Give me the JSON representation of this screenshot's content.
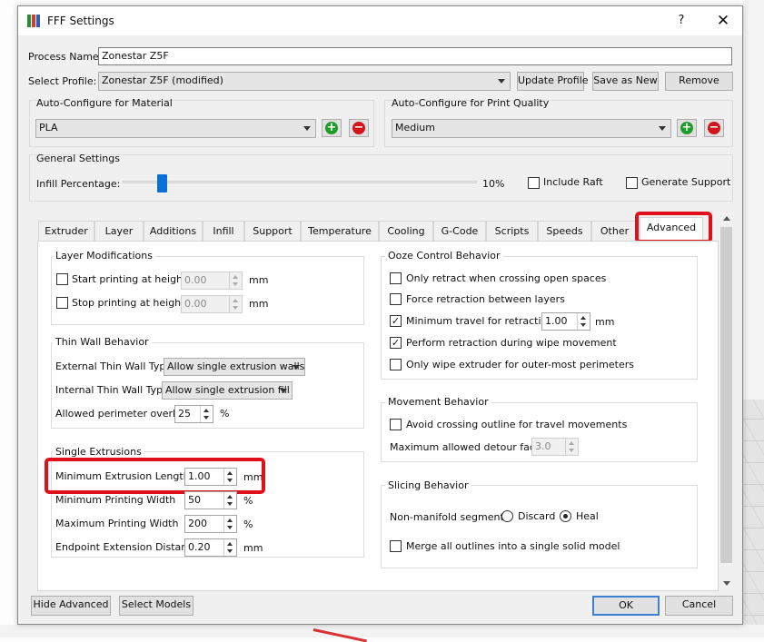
{
  "window": {
    "title": "FFF Settings",
    "help": "?",
    "close": "✕"
  },
  "process_name": {
    "label": "Process Name:",
    "value": "Zonestar Z5F"
  },
  "select_profile": {
    "label": "Select Profile:",
    "value": "Zonestar Z5F (modified)",
    "update": "Update Profile",
    "save_as_new": "Save as New",
    "remove": "Remove"
  },
  "material": {
    "title": "Auto-Configure for Material",
    "value": "PLA",
    "add": "+",
    "remove": "−"
  },
  "quality": {
    "title": "Auto-Configure for Print Quality",
    "value": "Medium",
    "add": "+",
    "remove": "−"
  },
  "general": {
    "title": "General Settings",
    "infill_label": "Infill Percentage:",
    "infill_value": "10%",
    "infill_fraction": 0.1,
    "include_raft": "Include Raft",
    "generate_support": "Generate Support"
  },
  "tabs": [
    "Extruder",
    "Layer",
    "Additions",
    "Infill",
    "Support",
    "Temperature",
    "Cooling",
    "G-Code",
    "Scripts",
    "Speeds",
    "Other",
    "Advanced"
  ],
  "layer_mod": {
    "title": "Layer Modifications",
    "start_label": "Start printing at height",
    "start_value": "0.00",
    "start_unit": "mm",
    "stop_label": "Stop printing at height",
    "stop_value": "0.00",
    "stop_unit": "mm"
  },
  "thin_wall": {
    "title": "Thin Wall Behavior",
    "external_label": "External Thin Wall Type",
    "external_value": "Allow single extrusion walls",
    "internal_label": "Internal Thin Wall Type",
    "internal_value": "Allow single extrusion fill",
    "overlap_label": "Allowed perimeter overlap",
    "overlap_value": "25",
    "overlap_unit": "%"
  },
  "single_ext": {
    "title": "Single Extrusions",
    "min_len_label": "Minimum Extrusion Length",
    "min_len_value": "1.00",
    "min_len_unit": "mm",
    "min_width_label": "Minimum Printing Width",
    "min_width_value": "50",
    "min_width_unit": "%",
    "max_width_label": "Maximum Printing Width",
    "max_width_value": "200",
    "max_width_unit": "%",
    "endpoint_label": "Endpoint Extension Distance",
    "endpoint_value": "0.20",
    "endpoint_unit": "mm"
  },
  "ooze": {
    "title": "Ooze Control Behavior",
    "only_retract": "Only retract when crossing open spaces",
    "force_retract": "Force retraction between layers",
    "min_travel": "Minimum travel for retraction",
    "min_travel_value": "1.00",
    "min_travel_unit": "mm",
    "wipe_retract": "Perform retraction during wipe movement",
    "only_wipe": "Only wipe extruder for outer-most perimeters",
    "check_marks": "✓"
  },
  "movement": {
    "title": "Movement Behavior",
    "avoid": "Avoid crossing outline for travel movements",
    "detour_label": "Maximum allowed detour factor",
    "detour_value": "3.0"
  },
  "slicing": {
    "title": "Slicing Behavior",
    "nonmanifold_label": "Non-manifold segments:",
    "discard": "Discard",
    "heal": "Heal",
    "merge": "Merge all outlines into a single solid model"
  },
  "footer": {
    "hide_advanced": "Hide Advanced",
    "select_models": "Select Models",
    "ok": "OK",
    "cancel": "Cancel"
  },
  "colors": {
    "accent": "#0a6fd8",
    "highlight": "#e0101a",
    "add": "#1f9d2a",
    "remove": "#d3141b"
  }
}
